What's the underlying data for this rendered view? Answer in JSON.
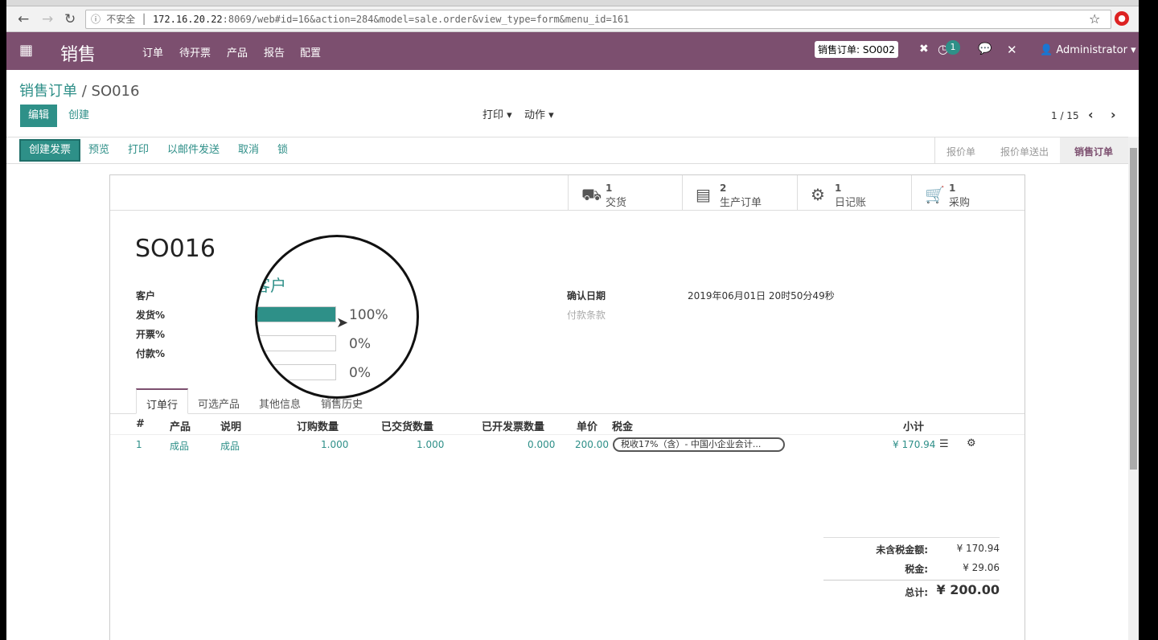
{
  "browser": {
    "security": "不安全",
    "url_host": "172.16.20.22",
    "url_rest": ":8069/web#id=16&action=284&model=sale.order&view_type=form&menu_id=161"
  },
  "navbar": {
    "app": "销售",
    "menus": [
      "订单",
      "待开票",
      "产品",
      "报告",
      "配置"
    ],
    "quick_search": "销售订单: SO002",
    "activity_count": "1",
    "user": "Administrator"
  },
  "breadcrumb": {
    "parent": "销售订单",
    "current": "SO016"
  },
  "controls": {
    "edit": "编辑",
    "create": "创建",
    "print": "打印",
    "action": "动作",
    "pager": "1 / 15"
  },
  "status_buttons": [
    "创建发票",
    "预览",
    "打印",
    "以邮件发送",
    "取消",
    "锁"
  ],
  "stages": [
    "报价单",
    "报价单送出",
    "销售订单"
  ],
  "smart_buttons": [
    {
      "count": "1",
      "label": "交货",
      "icon": "truck-icon"
    },
    {
      "count": "2",
      "label": "生产订单",
      "icon": "archive-icon"
    },
    {
      "count": "1",
      "label": "日记账",
      "icon": "cogs-icon"
    },
    {
      "count": "1",
      "label": "采购",
      "icon": "cart-icon"
    }
  ],
  "form": {
    "name": "SO016",
    "customer_label": "客户",
    "customer_value": "客户",
    "delivery_label": "发货%",
    "invoice_label": "开票%",
    "payment_label": "付款%",
    "delivery_pct": 100,
    "delivery_text": "100%",
    "invoice_pct": 0,
    "invoice_text": "0%",
    "payment_pct": 0,
    "payment_text": "0%",
    "confirm_label": "确认日期",
    "confirm_value": "2019年06月01日 20时50分49秒",
    "terms_label": "付款条款"
  },
  "tabs": [
    "订单行",
    "可选产品",
    "其他信息",
    "销售历史"
  ],
  "table": {
    "headers": [
      "#",
      "产品",
      "说明",
      "订购数量",
      "已交货数量",
      "已开发票数量",
      "单价",
      "税金",
      "小计"
    ],
    "rows": [
      {
        "seq": "1",
        "product": "成品",
        "desc": "成品",
        "qty": "1.000",
        "delivered": "1.000",
        "invoiced": "0.000",
        "price": "200.00",
        "tax": "税收17%（含）- 中国小企业会计...",
        "subtotal": "¥ 170.94"
      }
    ]
  },
  "totals": {
    "untaxed_label": "未含税金额:",
    "untaxed": "¥ 170.94",
    "tax_label": "税金:",
    "tax": "¥ 29.06",
    "total_label": "总计:",
    "total": "¥ 200.00"
  },
  "colors": {
    "brand": "#7c4f6f",
    "accent": "#2e9088"
  }
}
